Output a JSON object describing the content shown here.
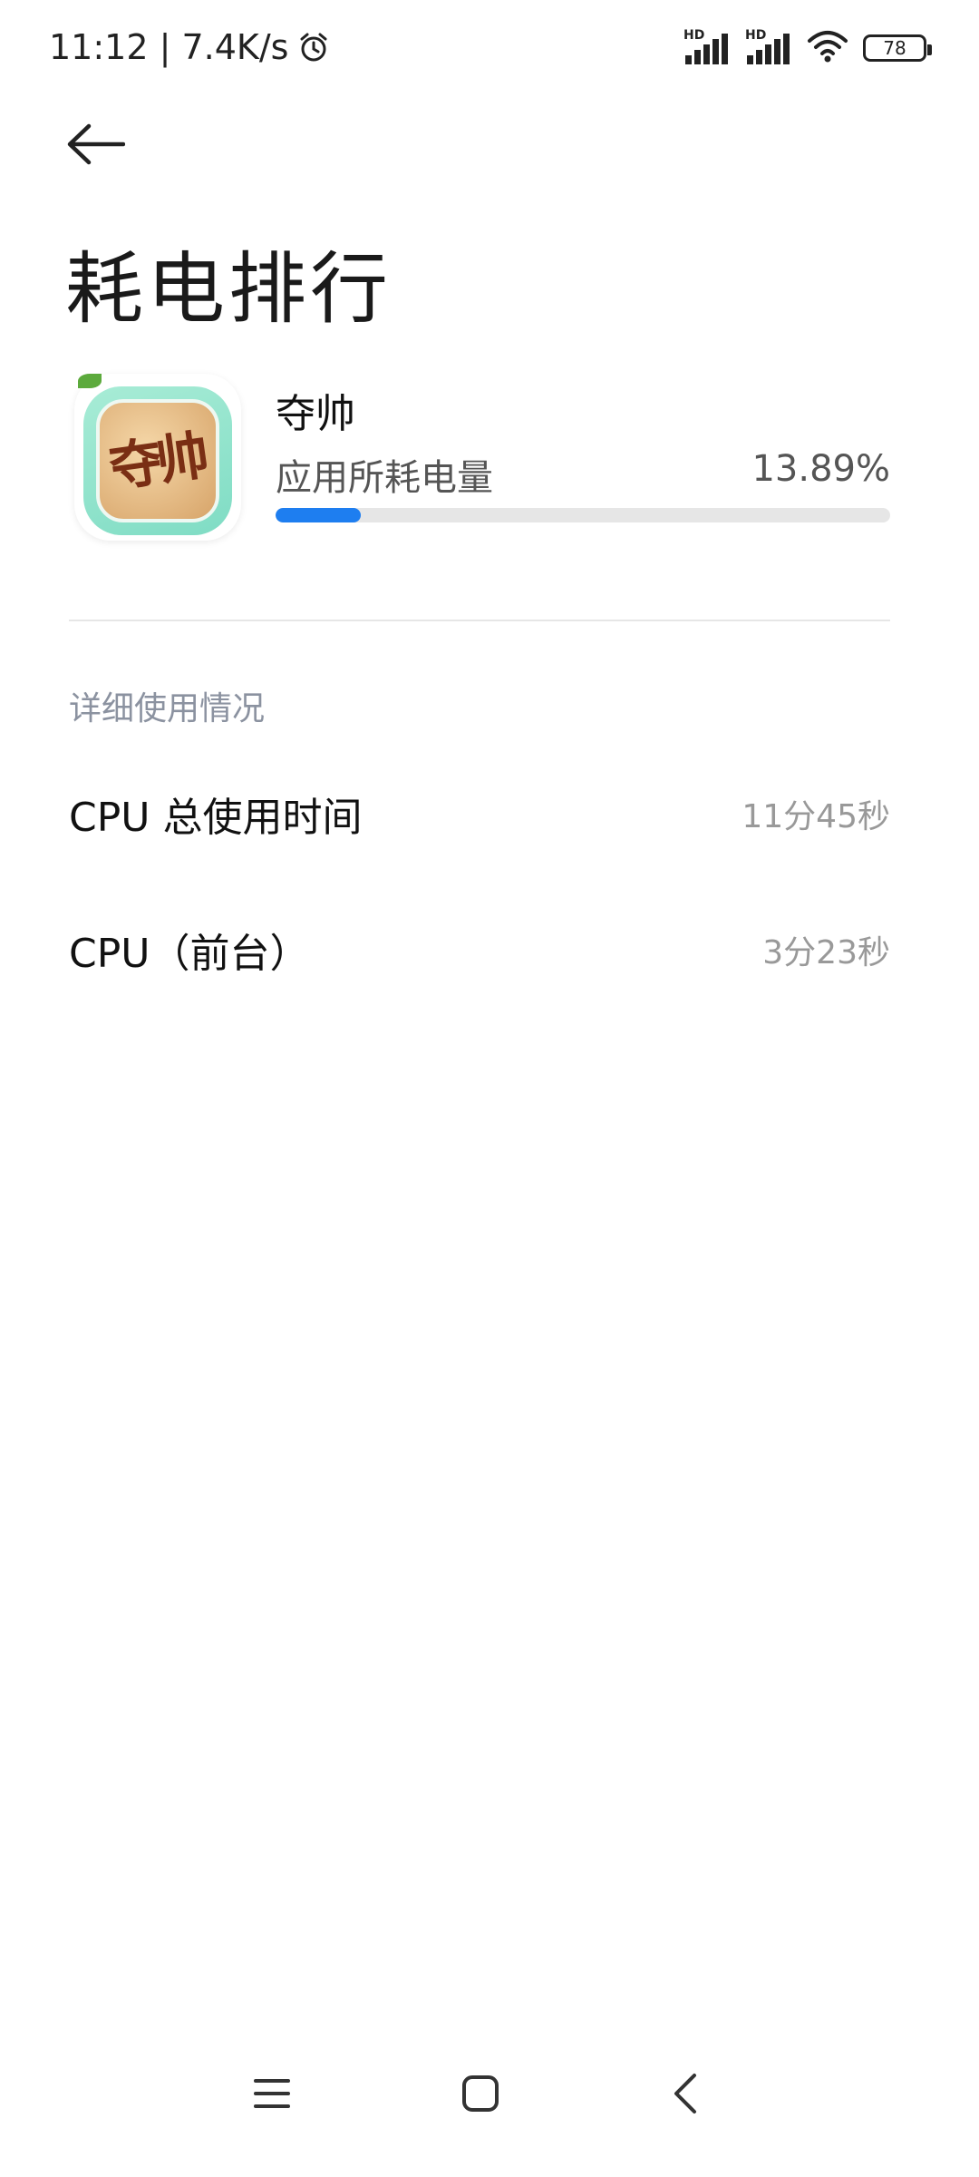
{
  "status_bar": {
    "time_speed": "11:12 | 7.4K/s",
    "signal1_label": "HD",
    "signal2_label": "HD",
    "battery_level": "78"
  },
  "header": {
    "title": "耗电排行"
  },
  "app": {
    "name": "夺帅",
    "usage_label": "应用所耗电量",
    "usage_value": "13.89%",
    "usage_fraction": 0.1389
  },
  "details": {
    "section_title": "详细使用情况",
    "rows": [
      {
        "label": "CPU 总使用时间",
        "value": "11分45秒"
      },
      {
        "label": "CPU（前台）",
        "value": "3分23秒"
      }
    ]
  },
  "icons": {
    "back": "back-arrow-icon",
    "alarm": "alarm-clock-icon",
    "wifi": "wifi-icon",
    "nav_menu": "menu-icon",
    "nav_home": "home-icon",
    "nav_back": "back-chevron-icon"
  },
  "colors": {
    "accent": "#1e7ef0",
    "section_header": "#8b92a0"
  }
}
